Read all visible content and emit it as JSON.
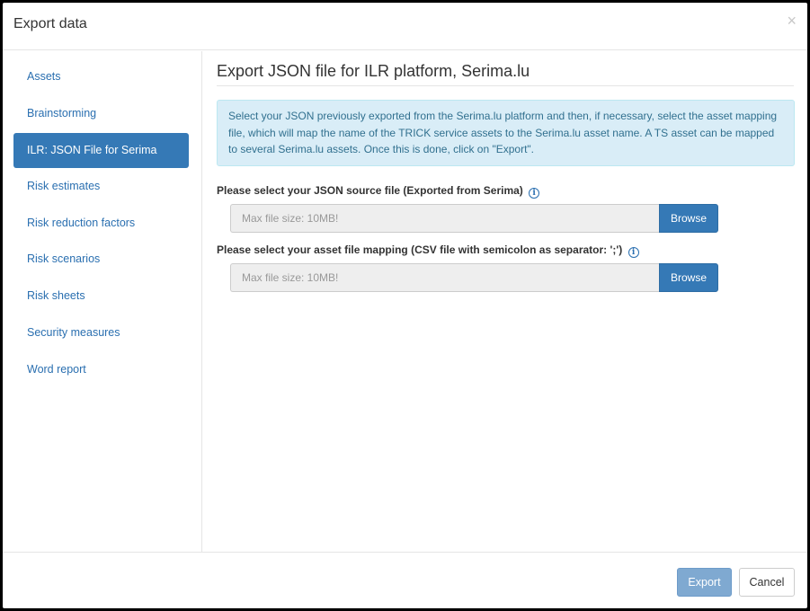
{
  "header": {
    "title": "Export data",
    "close_label": "×"
  },
  "sidebar": {
    "items": [
      {
        "label": "Assets",
        "active": false
      },
      {
        "label": "Brainstorming",
        "active": false
      },
      {
        "label": "ILR: JSON File for Serima",
        "active": true
      },
      {
        "label": "Risk estimates",
        "active": false
      },
      {
        "label": "Risk reduction factors",
        "active": false
      },
      {
        "label": "Risk scenarios",
        "active": false
      },
      {
        "label": "Risk sheets",
        "active": false
      },
      {
        "label": "Security measures",
        "active": false
      },
      {
        "label": "Word report",
        "active": false
      }
    ]
  },
  "main": {
    "title": "Export JSON file for ILR platform, Serima.lu",
    "info_text": "Select your JSON previously exported from the Serima.lu platform and then, if necessary, select the asset mapping file, which will map the name of the TRICK service assets to the Serima.lu asset name. A TS asset can be mapped to several Serima.lu assets. Once this is done, click on \"Export\".",
    "json_field": {
      "label": "Please select your JSON source file (Exported from Serima)",
      "placeholder": "Max file size: 10MB!",
      "browse_label": "Browse"
    },
    "mapping_field": {
      "label": "Please select your asset file mapping (CSV file with semicolon as separator: ';')",
      "placeholder": "Max file size: 10MB!",
      "browse_label": "Browse"
    },
    "info_icon_glyph": "i"
  },
  "footer": {
    "export_label": "Export",
    "cancel_label": "Cancel"
  },
  "colors": {
    "accent": "#3579b6",
    "link": "#2a6fb0",
    "info_bg": "#d9edf7",
    "info_text": "#31708f",
    "export_disabled": "#7fa9d1"
  }
}
